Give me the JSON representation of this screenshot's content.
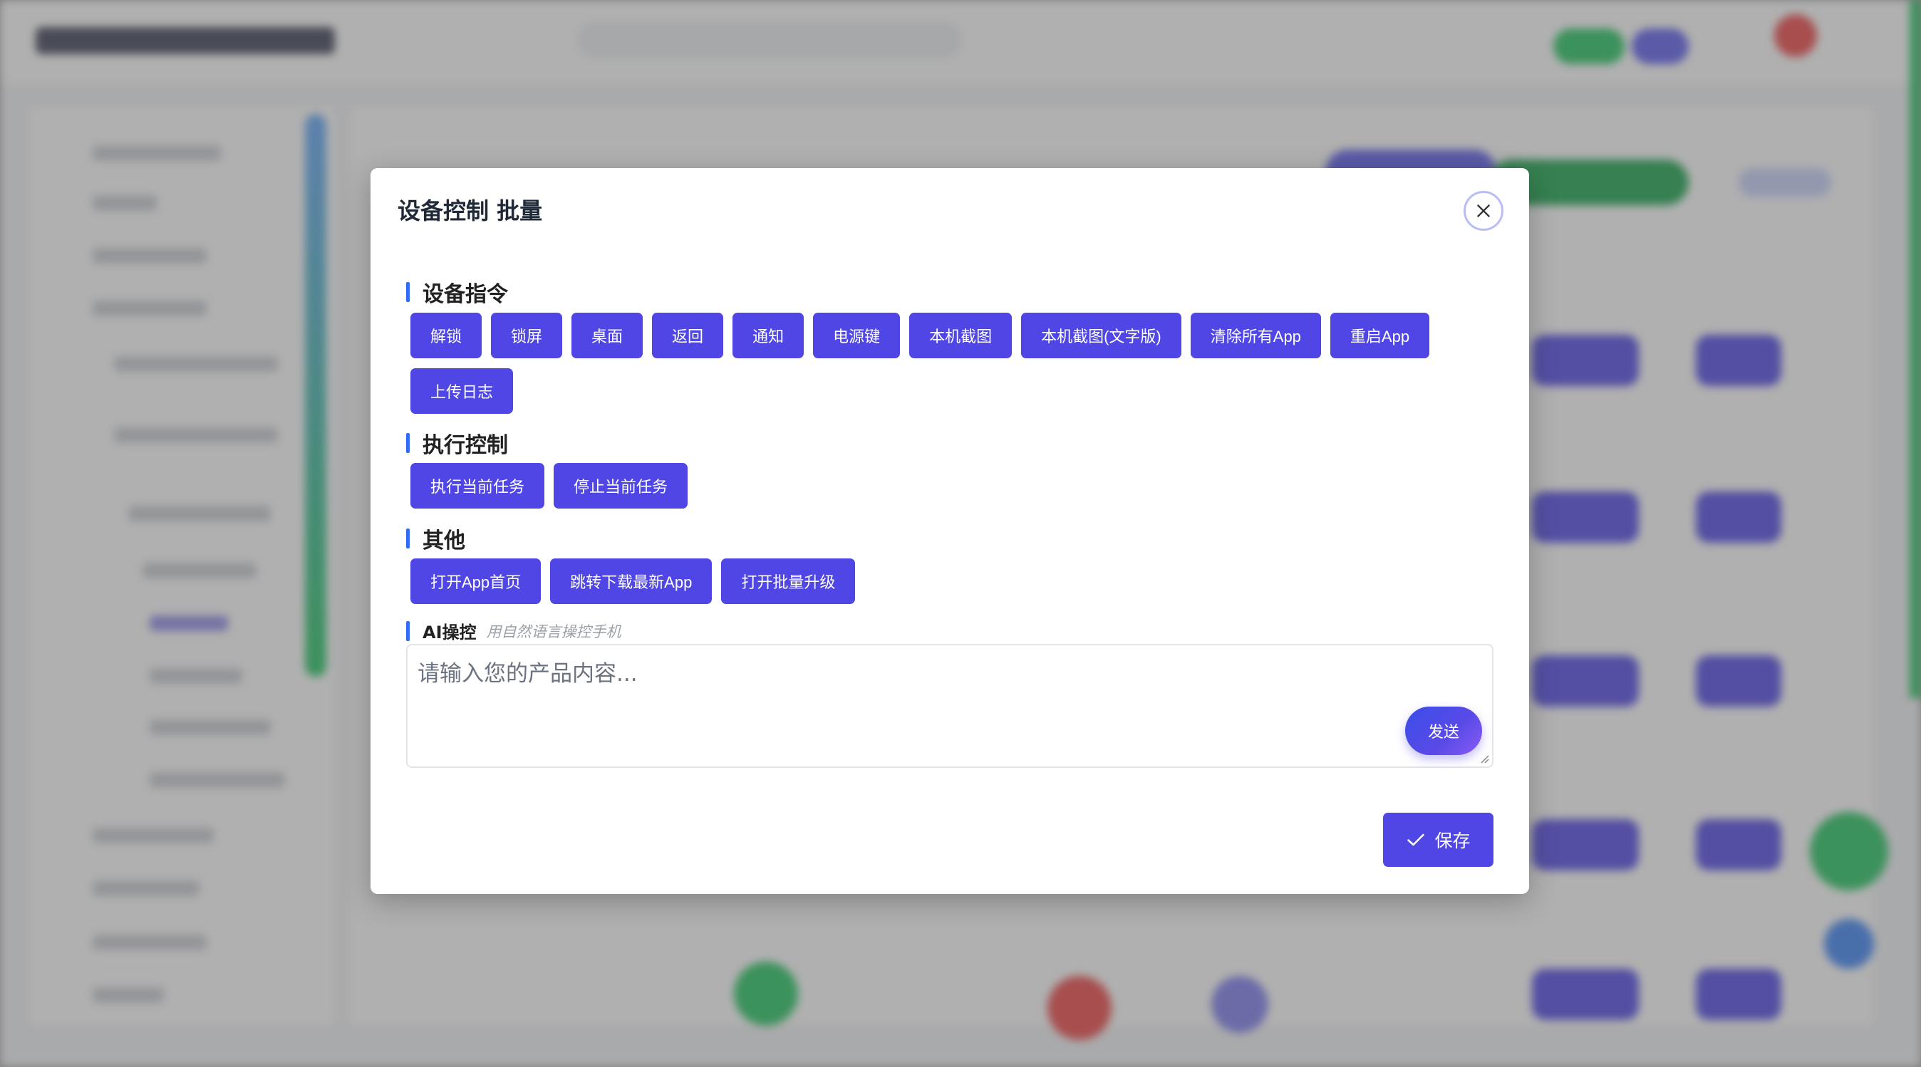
{
  "modal": {
    "title": "设备控制 批量",
    "sections": {
      "device_commands": {
        "title": "设备指令",
        "buttons": [
          "解锁",
          "锁屏",
          "桌面",
          "返回",
          "通知",
          "电源键",
          "本机截图",
          "本机截图(文字版)",
          "清除所有App",
          "重启App",
          "上传日志"
        ]
      },
      "execution_control": {
        "title": "执行控制",
        "buttons": [
          "执行当前任务",
          "停止当前任务"
        ]
      },
      "other": {
        "title": "其他",
        "buttons": [
          "打开App首页",
          "跳转下载最新App",
          "打开批量升级"
        ]
      },
      "ai_control": {
        "title": "AI操控",
        "hint": "用自然语言操控手机",
        "placeholder": "请输入您的产品内容...",
        "send_label": "发送"
      }
    },
    "save_label": "保存",
    "icons": {
      "close": "close-icon",
      "save": "check-icon"
    }
  },
  "colors": {
    "primary": "#4f46e5",
    "section_bar": "#2f6bf5",
    "overlay": "#5a5a5a"
  }
}
